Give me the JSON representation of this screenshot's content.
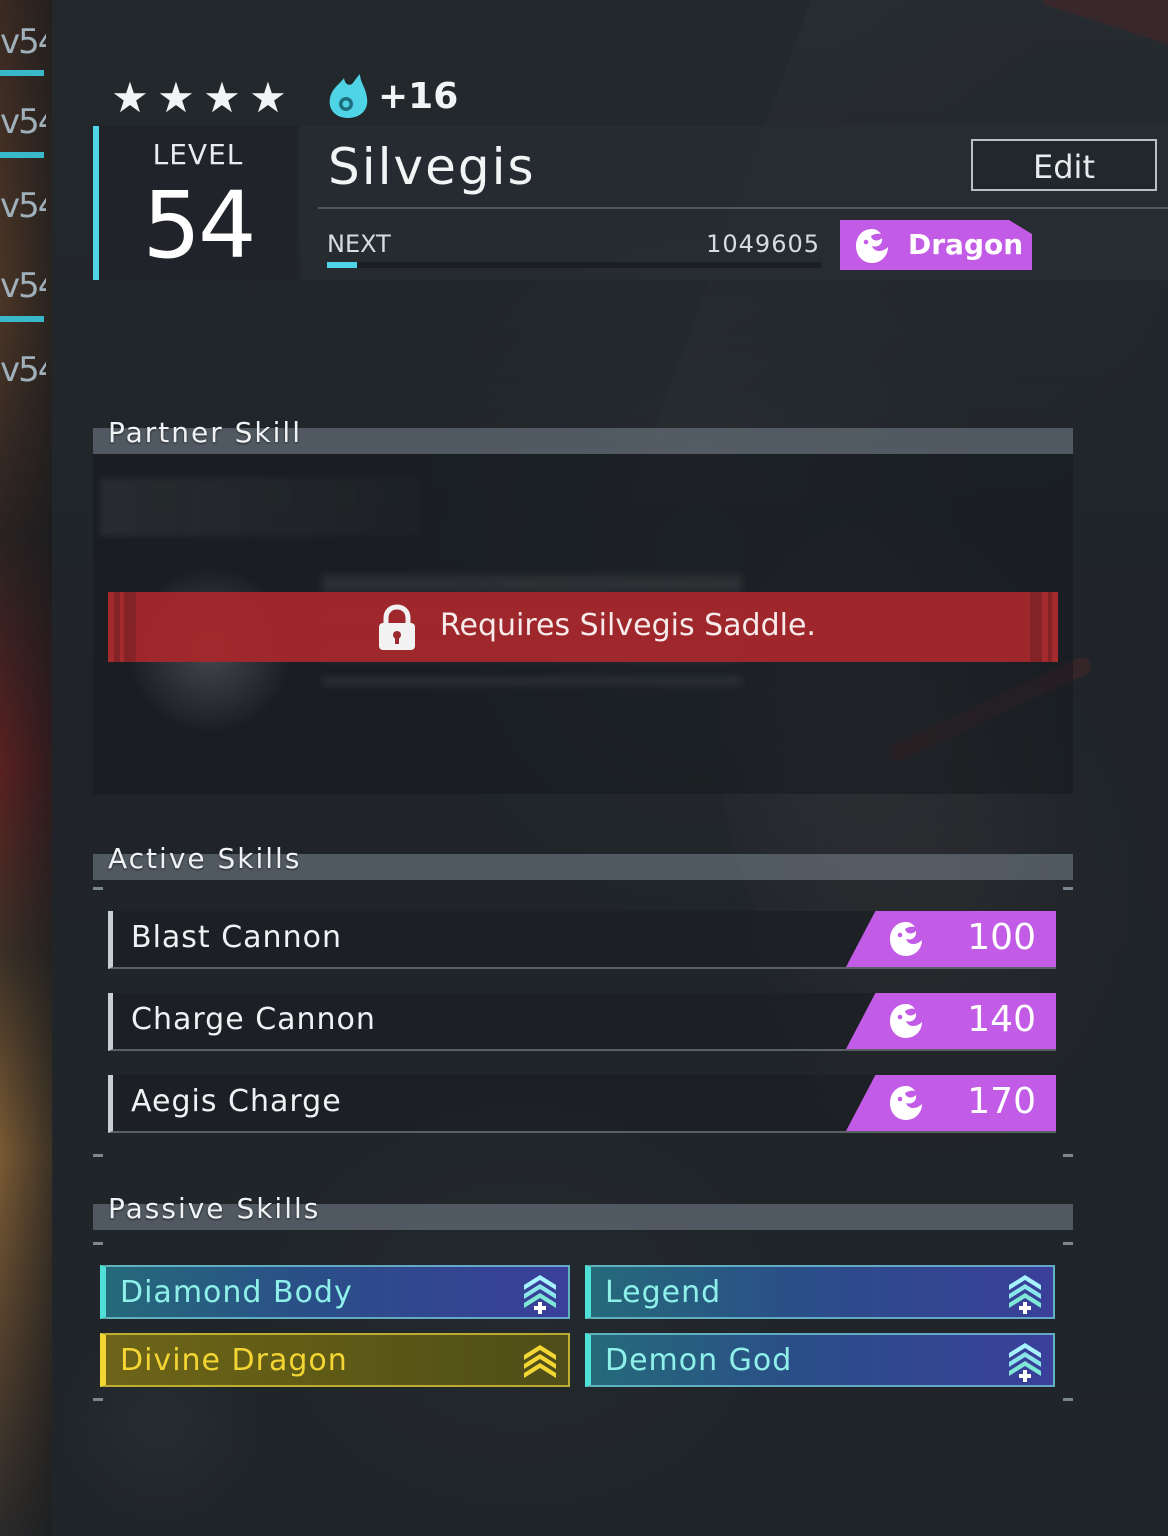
{
  "pal": {
    "stars": 4,
    "condenser_bonus": "+16",
    "level_label": "LEVEL",
    "level": "54",
    "name": "Silvegis",
    "edit_label": "Edit",
    "next_label": "NEXT",
    "next_exp": "1049605",
    "exp_progress": 0.06,
    "element": "Dragon"
  },
  "sidebar": {
    "levels": [
      "v54",
      "v54",
      "v54",
      "v54",
      "v54"
    ]
  },
  "partner_skill": {
    "title": "Partner Skill",
    "lock_message": "Requires Silvegis Saddle."
  },
  "active_skills": {
    "title": "Active Skills",
    "items": [
      {
        "name": "Blast Cannon",
        "element": "Dragon",
        "power": "100"
      },
      {
        "name": "Charge Cannon",
        "element": "Dragon",
        "power": "140"
      },
      {
        "name": "Aegis Charge",
        "element": "Dragon",
        "power": "170"
      }
    ]
  },
  "passive_skills": {
    "title": "Passive Skills",
    "items": [
      {
        "name": "Diamond Body",
        "tier": "rainbow",
        "icon": "rank-up-plus-icon"
      },
      {
        "name": "Legend",
        "tier": "rainbow",
        "icon": "rank-up-plus-icon"
      },
      {
        "name": "Divine Dragon",
        "tier": "gold",
        "icon": "rank-up-triple-icon"
      },
      {
        "name": "Demon God",
        "tier": "rainbow",
        "icon": "rank-up-plus-icon"
      }
    ]
  },
  "colors": {
    "dragon": "#c25ce6",
    "accent": "#4fd4e6",
    "lock_banner": "#a52a2e",
    "gold": "#f3d533"
  }
}
